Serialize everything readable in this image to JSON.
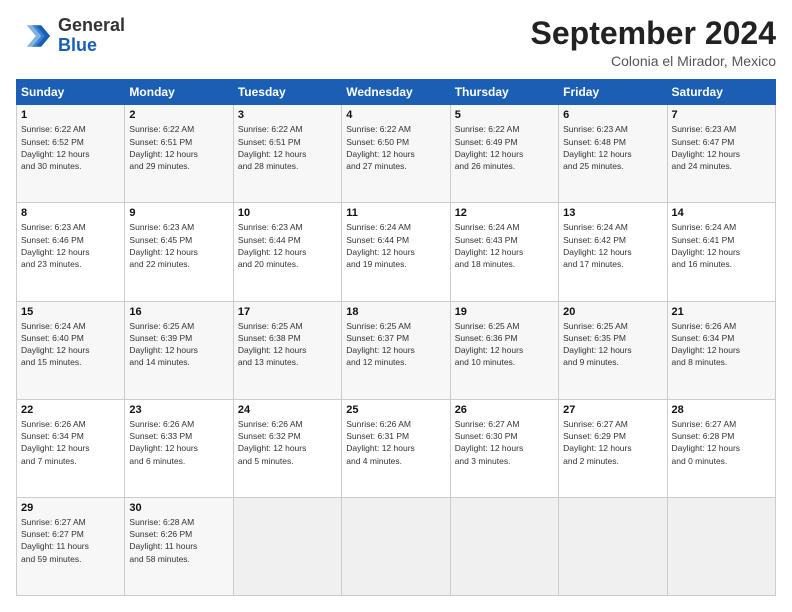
{
  "header": {
    "logo_line1": "General",
    "logo_line2": "Blue",
    "month": "September 2024",
    "location": "Colonia el Mirador, Mexico"
  },
  "weekdays": [
    "Sunday",
    "Monday",
    "Tuesday",
    "Wednesday",
    "Thursday",
    "Friday",
    "Saturday"
  ],
  "weeks": [
    [
      {
        "day": "1",
        "info": "Sunrise: 6:22 AM\nSunset: 6:52 PM\nDaylight: 12 hours\nand 30 minutes."
      },
      {
        "day": "2",
        "info": "Sunrise: 6:22 AM\nSunset: 6:51 PM\nDaylight: 12 hours\nand 29 minutes."
      },
      {
        "day": "3",
        "info": "Sunrise: 6:22 AM\nSunset: 6:51 PM\nDaylight: 12 hours\nand 28 minutes."
      },
      {
        "day": "4",
        "info": "Sunrise: 6:22 AM\nSunset: 6:50 PM\nDaylight: 12 hours\nand 27 minutes."
      },
      {
        "day": "5",
        "info": "Sunrise: 6:22 AM\nSunset: 6:49 PM\nDaylight: 12 hours\nand 26 minutes."
      },
      {
        "day": "6",
        "info": "Sunrise: 6:23 AM\nSunset: 6:48 PM\nDaylight: 12 hours\nand 25 minutes."
      },
      {
        "day": "7",
        "info": "Sunrise: 6:23 AM\nSunset: 6:47 PM\nDaylight: 12 hours\nand 24 minutes."
      }
    ],
    [
      {
        "day": "8",
        "info": "Sunrise: 6:23 AM\nSunset: 6:46 PM\nDaylight: 12 hours\nand 23 minutes."
      },
      {
        "day": "9",
        "info": "Sunrise: 6:23 AM\nSunset: 6:45 PM\nDaylight: 12 hours\nand 22 minutes."
      },
      {
        "day": "10",
        "info": "Sunrise: 6:23 AM\nSunset: 6:44 PM\nDaylight: 12 hours\nand 20 minutes."
      },
      {
        "day": "11",
        "info": "Sunrise: 6:24 AM\nSunset: 6:44 PM\nDaylight: 12 hours\nand 19 minutes."
      },
      {
        "day": "12",
        "info": "Sunrise: 6:24 AM\nSunset: 6:43 PM\nDaylight: 12 hours\nand 18 minutes."
      },
      {
        "day": "13",
        "info": "Sunrise: 6:24 AM\nSunset: 6:42 PM\nDaylight: 12 hours\nand 17 minutes."
      },
      {
        "day": "14",
        "info": "Sunrise: 6:24 AM\nSunset: 6:41 PM\nDaylight: 12 hours\nand 16 minutes."
      }
    ],
    [
      {
        "day": "15",
        "info": "Sunrise: 6:24 AM\nSunset: 6:40 PM\nDaylight: 12 hours\nand 15 minutes."
      },
      {
        "day": "16",
        "info": "Sunrise: 6:25 AM\nSunset: 6:39 PM\nDaylight: 12 hours\nand 14 minutes."
      },
      {
        "day": "17",
        "info": "Sunrise: 6:25 AM\nSunset: 6:38 PM\nDaylight: 12 hours\nand 13 minutes."
      },
      {
        "day": "18",
        "info": "Sunrise: 6:25 AM\nSunset: 6:37 PM\nDaylight: 12 hours\nand 12 minutes."
      },
      {
        "day": "19",
        "info": "Sunrise: 6:25 AM\nSunset: 6:36 PM\nDaylight: 12 hours\nand 10 minutes."
      },
      {
        "day": "20",
        "info": "Sunrise: 6:25 AM\nSunset: 6:35 PM\nDaylight: 12 hours\nand 9 minutes."
      },
      {
        "day": "21",
        "info": "Sunrise: 6:26 AM\nSunset: 6:34 PM\nDaylight: 12 hours\nand 8 minutes."
      }
    ],
    [
      {
        "day": "22",
        "info": "Sunrise: 6:26 AM\nSunset: 6:34 PM\nDaylight: 12 hours\nand 7 minutes."
      },
      {
        "day": "23",
        "info": "Sunrise: 6:26 AM\nSunset: 6:33 PM\nDaylight: 12 hours\nand 6 minutes."
      },
      {
        "day": "24",
        "info": "Sunrise: 6:26 AM\nSunset: 6:32 PM\nDaylight: 12 hours\nand 5 minutes."
      },
      {
        "day": "25",
        "info": "Sunrise: 6:26 AM\nSunset: 6:31 PM\nDaylight: 12 hours\nand 4 minutes."
      },
      {
        "day": "26",
        "info": "Sunrise: 6:27 AM\nSunset: 6:30 PM\nDaylight: 12 hours\nand 3 minutes."
      },
      {
        "day": "27",
        "info": "Sunrise: 6:27 AM\nSunset: 6:29 PM\nDaylight: 12 hours\nand 2 minutes."
      },
      {
        "day": "28",
        "info": "Sunrise: 6:27 AM\nSunset: 6:28 PM\nDaylight: 12 hours\nand 0 minutes."
      }
    ],
    [
      {
        "day": "29",
        "info": "Sunrise: 6:27 AM\nSunset: 6:27 PM\nDaylight: 11 hours\nand 59 minutes."
      },
      {
        "day": "30",
        "info": "Sunrise: 6:28 AM\nSunset: 6:26 PM\nDaylight: 11 hours\nand 58 minutes."
      },
      {
        "day": "",
        "info": ""
      },
      {
        "day": "",
        "info": ""
      },
      {
        "day": "",
        "info": ""
      },
      {
        "day": "",
        "info": ""
      },
      {
        "day": "",
        "info": ""
      }
    ]
  ]
}
